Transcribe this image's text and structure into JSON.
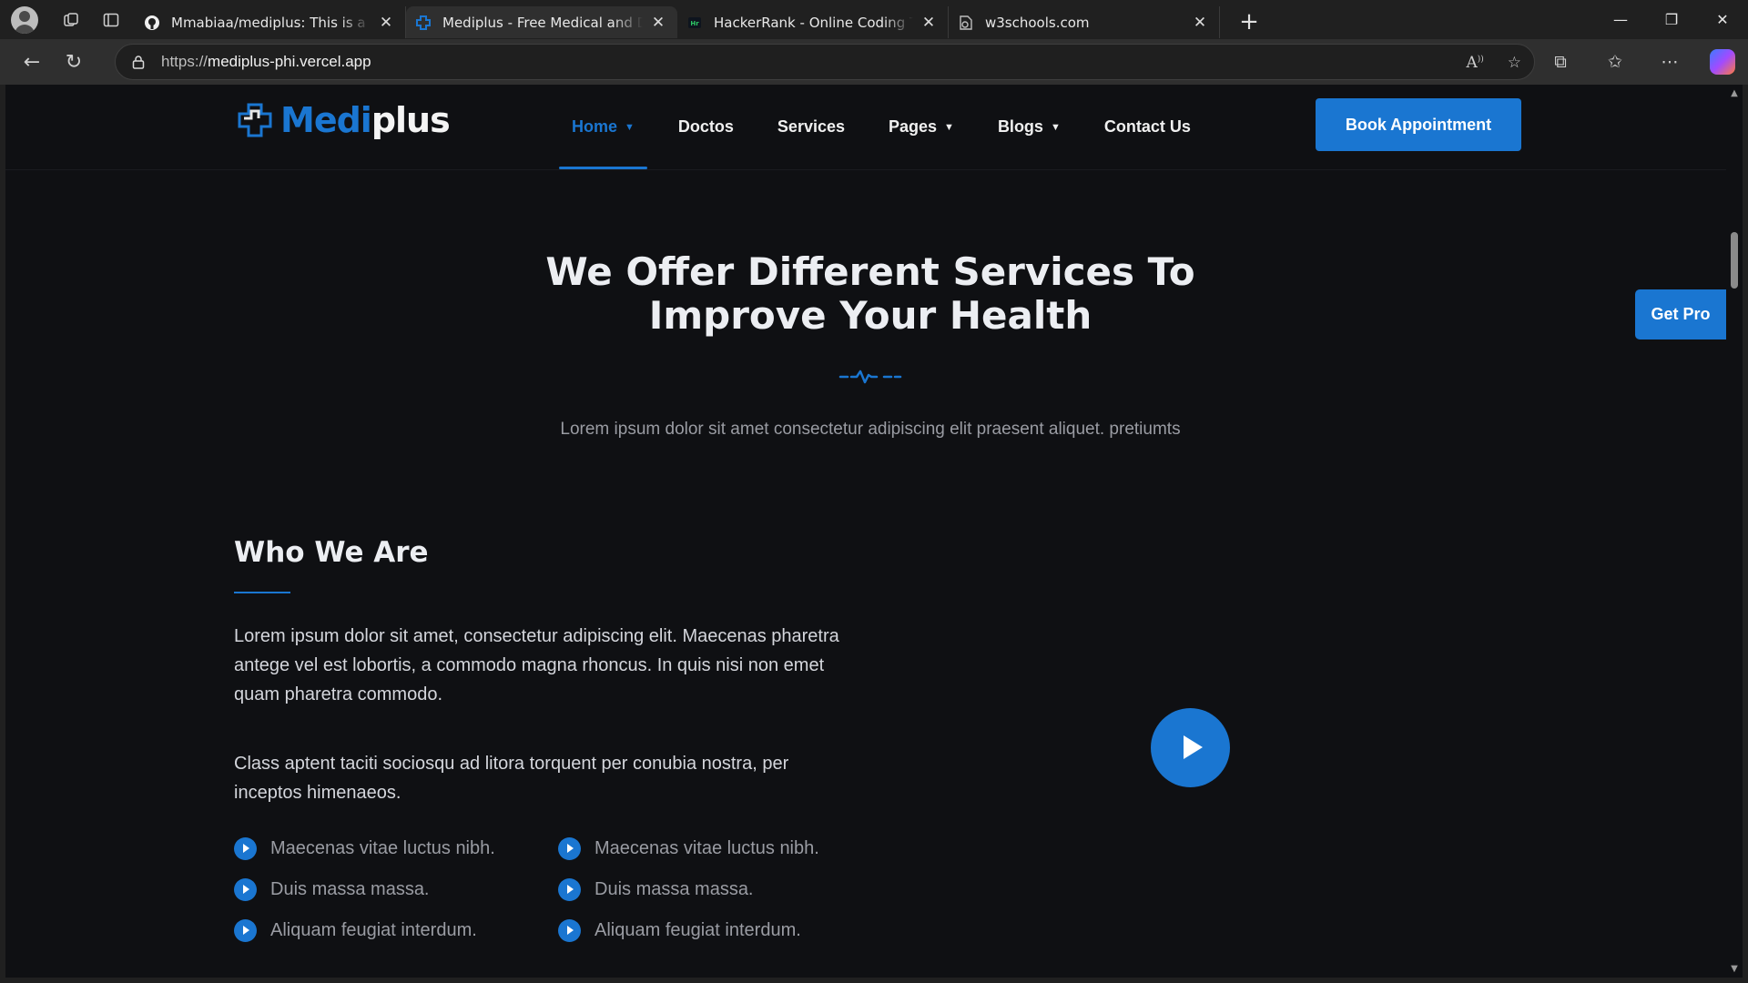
{
  "browser": {
    "tabs": [
      {
        "title": "Mmabiaa/mediplus: This is a simple",
        "favicon": "github-icon"
      },
      {
        "title": "Mediplus - Free Medical and Doctor",
        "favicon": "mediplus-icon",
        "active": true
      },
      {
        "title": "HackerRank - Online Coding Tests",
        "favicon": "hackerrank-icon"
      },
      {
        "title": "w3schools.com",
        "favicon": "w3schools-icon"
      }
    ],
    "url_prefix": "https://",
    "url_host": "mediplus-phi.vercel.app"
  },
  "site": {
    "logo": {
      "prefix": "Medi",
      "suffix": "plus"
    },
    "nav": [
      {
        "label": "Home",
        "has_caret": true,
        "active": true
      },
      {
        "label": "Doctos",
        "has_caret": false
      },
      {
        "label": "Services",
        "has_caret": false
      },
      {
        "label": "Pages",
        "has_caret": true
      },
      {
        "label": "Blogs",
        "has_caret": true
      },
      {
        "label": "Contact Us",
        "has_caret": false
      }
    ],
    "book_button": "Book Appointment",
    "get_pro": "Get Pro",
    "accent_color": "#1a76d1"
  },
  "services": {
    "title": "We Offer Different Services To Improve Your Health",
    "subtitle": "Lorem ipsum dolor sit amet consectetur adipiscing elit praesent aliquet. pretiumts"
  },
  "who": {
    "title": "Who We Are",
    "paragraph1": "Lorem ipsum dolor sit amet, consectetur adipiscing elit. Maecenas pharetra antege vel est lobortis, a commodo magna rhoncus. In quis nisi non emet quam pharetra commodo.",
    "paragraph2": "Class aptent taciti sociosqu ad litora torquent per conubia nostra, per inceptos himenaeos.",
    "list_col1": [
      "Maecenas vitae luctus nibh.",
      "Duis massa massa.",
      "Aliquam feugiat interdum."
    ],
    "list_col2": [
      "Maecenas vitae luctus nibh.",
      "Duis massa massa.",
      "Aliquam feugiat interdum."
    ]
  }
}
